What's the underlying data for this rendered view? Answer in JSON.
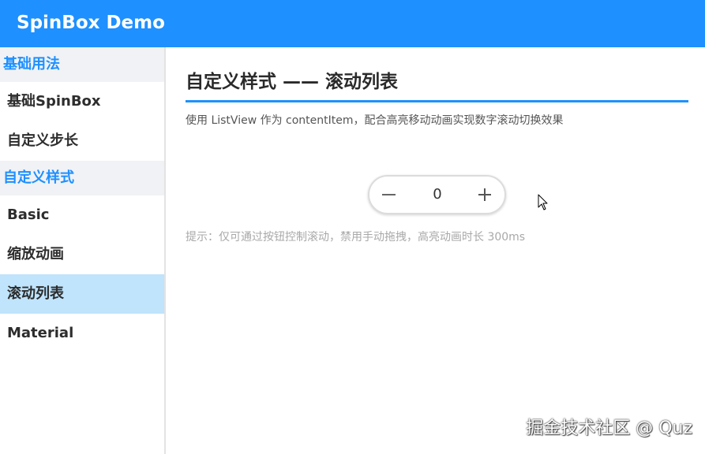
{
  "app": {
    "title": "SpinBox Demo",
    "accent_color": "#1e90ff"
  },
  "sidebar": {
    "groups": [
      {
        "label": "基础用法",
        "items": [
          {
            "label": "基础SpinBox"
          },
          {
            "label": "自定义步长"
          }
        ]
      },
      {
        "label": "自定义样式",
        "items": [
          {
            "label": "Basic"
          },
          {
            "label": "缩放动画"
          },
          {
            "label": "滚动列表",
            "active": true
          },
          {
            "label": "Material"
          }
        ]
      }
    ]
  },
  "main": {
    "title": "自定义样式 —— 滚动列表",
    "description": "使用 ListView 作为 contentItem，配合高亮移动动画实现数字滚动切换效果",
    "spinbox": {
      "value": "0",
      "decrement_icon": "minus-icon",
      "increment_icon": "plus-icon"
    },
    "hint": "提示：仅可通过按钮控制滚动，禁用手动拖拽，高亮动画时长 300ms"
  },
  "watermark": "掘金技术社区 @ Quz"
}
